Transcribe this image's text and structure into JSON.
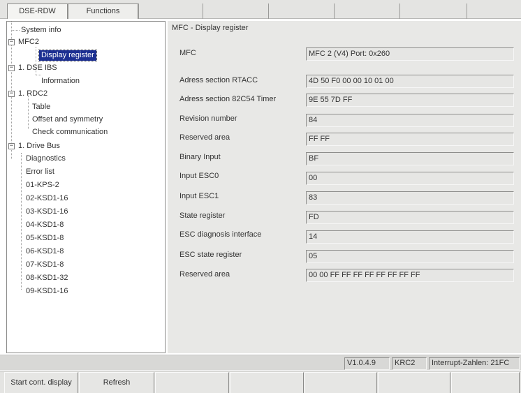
{
  "menubar": {
    "tabs": [
      {
        "label": "DSE-RDW"
      },
      {
        "label": "Functions"
      }
    ]
  },
  "tree": {
    "items": [
      {
        "label": "System info",
        "expander": ""
      },
      {
        "label": "MFC2",
        "expander": "−"
      },
      {
        "label": "Display register",
        "expander": "",
        "selected": true
      },
      {
        "label": "1. DSE IBS",
        "expander": "−"
      },
      {
        "label": "Information",
        "expander": ""
      },
      {
        "label": "1. RDC2",
        "expander": "−"
      },
      {
        "label": "Table",
        "expander": ""
      },
      {
        "label": "Offset and symmetry",
        "expander": ""
      },
      {
        "label": "Check communication",
        "expander": ""
      },
      {
        "label": "1. Drive Bus",
        "expander": "−"
      },
      {
        "label": "Diagnostics",
        "expander": ""
      },
      {
        "label": "Error list",
        "expander": ""
      },
      {
        "label": "01-KPS-2",
        "expander": ""
      },
      {
        "label": "02-KSD1-16",
        "expander": ""
      },
      {
        "label": "03-KSD1-16",
        "expander": ""
      },
      {
        "label": "04-KSD1-8",
        "expander": ""
      },
      {
        "label": "05-KSD1-8",
        "expander": ""
      },
      {
        "label": "06-KSD1-8",
        "expander": ""
      },
      {
        "label": "07-KSD1-8",
        "expander": ""
      },
      {
        "label": "08-KSD1-32",
        "expander": ""
      },
      {
        "label": "09-KSD1-16",
        "expander": ""
      }
    ]
  },
  "panel": {
    "title": "MFC - Display register",
    "registers": [
      {
        "label": "MFC",
        "value": "MFC 2 (V4) Port: 0x260"
      },
      {
        "label": "Adress section RTACC",
        "value": "4D 50 F0 00 00 10 01 00"
      },
      {
        "label": "Adress section 82C54 Timer",
        "value": "9E 55 7D FF"
      },
      {
        "label": "Revision number",
        "value": "84"
      },
      {
        "label": "Reserved area",
        "value": "FF FF"
      },
      {
        "label": "Binary Input",
        "value": "BF"
      },
      {
        "label": "Input ESC0",
        "value": "00"
      },
      {
        "label": "Input ESC1",
        "value": "83"
      },
      {
        "label": "State register",
        "value": "FD"
      },
      {
        "label": "ESC diagnosis interface",
        "value": "14"
      },
      {
        "label": "ESC state register",
        "value": "05"
      },
      {
        "label": "Reserved area",
        "value": "00 00 FF FF FF FF FF FF FF FF"
      }
    ]
  },
  "statusbar": {
    "version": "V1.0.4.9",
    "robot": "KRC2",
    "interrupt": "Interrupt-Zahlen: 21FC"
  },
  "buttonbar": {
    "buttons": [
      {
        "label": "Start cont. display"
      },
      {
        "label": "Refresh"
      },
      {
        "label": ""
      },
      {
        "label": ""
      },
      {
        "label": ""
      },
      {
        "label": ""
      },
      {
        "label": ""
      },
      {
        "label": ""
      }
    ]
  }
}
